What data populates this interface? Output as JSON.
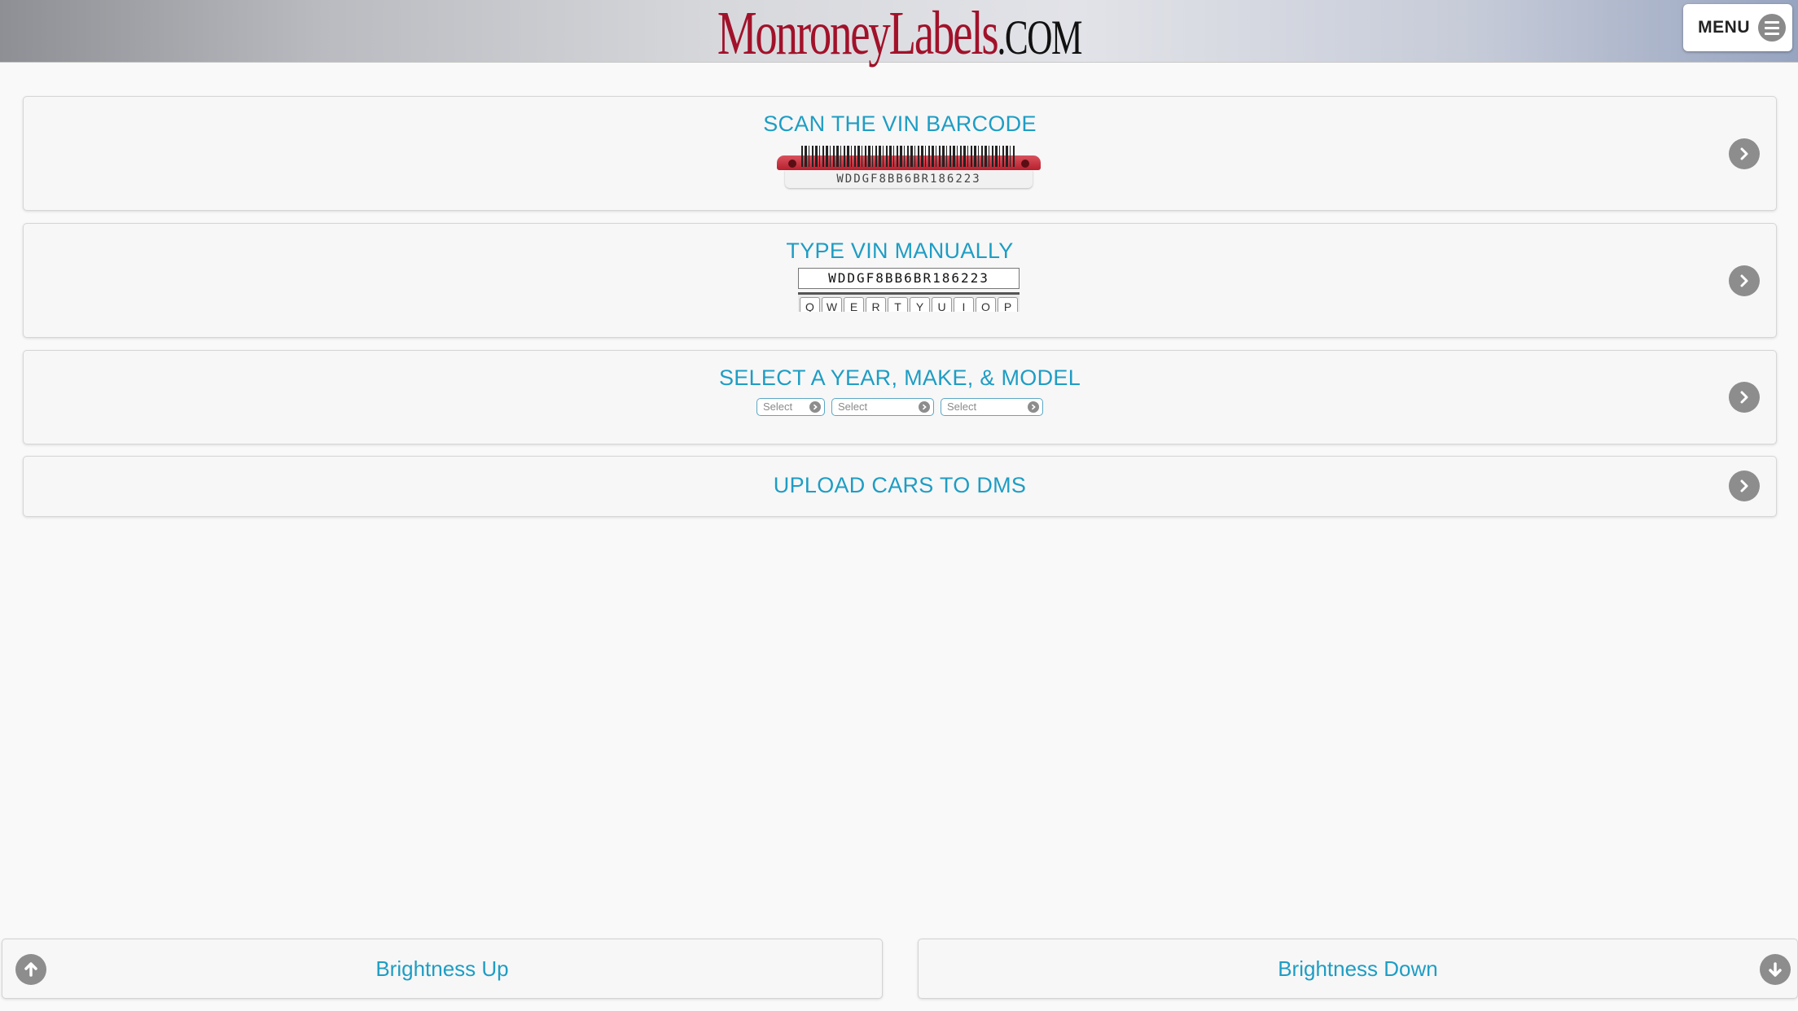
{
  "header": {
    "logo_main": "MonroneyLabels",
    "logo_suffix": ".COM",
    "menu_label": "MENU"
  },
  "options": [
    {
      "title": "SCAN THE VIN BARCODE",
      "barcode_vin": "WDDGF8BB6BR186223"
    },
    {
      "title": "TYPE VIN MANUALLY",
      "vin_value": "WDDGF8BB6BR186223",
      "keyboard_keys": [
        "Q",
        "W",
        "E",
        "R",
        "T",
        "Y",
        "U",
        "I",
        "O",
        "P"
      ]
    },
    {
      "title": "SELECT A YEAR, MAKE, & MODEL",
      "selects": [
        "Select",
        "Select",
        "Select"
      ]
    },
    {
      "title": "UPLOAD CARS TO DMS"
    }
  ],
  "footer": {
    "brightness_up": "Brightness Up",
    "brightness_down": "Brightness Down"
  },
  "colors": {
    "accent": "#1e9dc4",
    "logo_red": "#a1122a",
    "icon_gray": "#8d8d8d"
  }
}
